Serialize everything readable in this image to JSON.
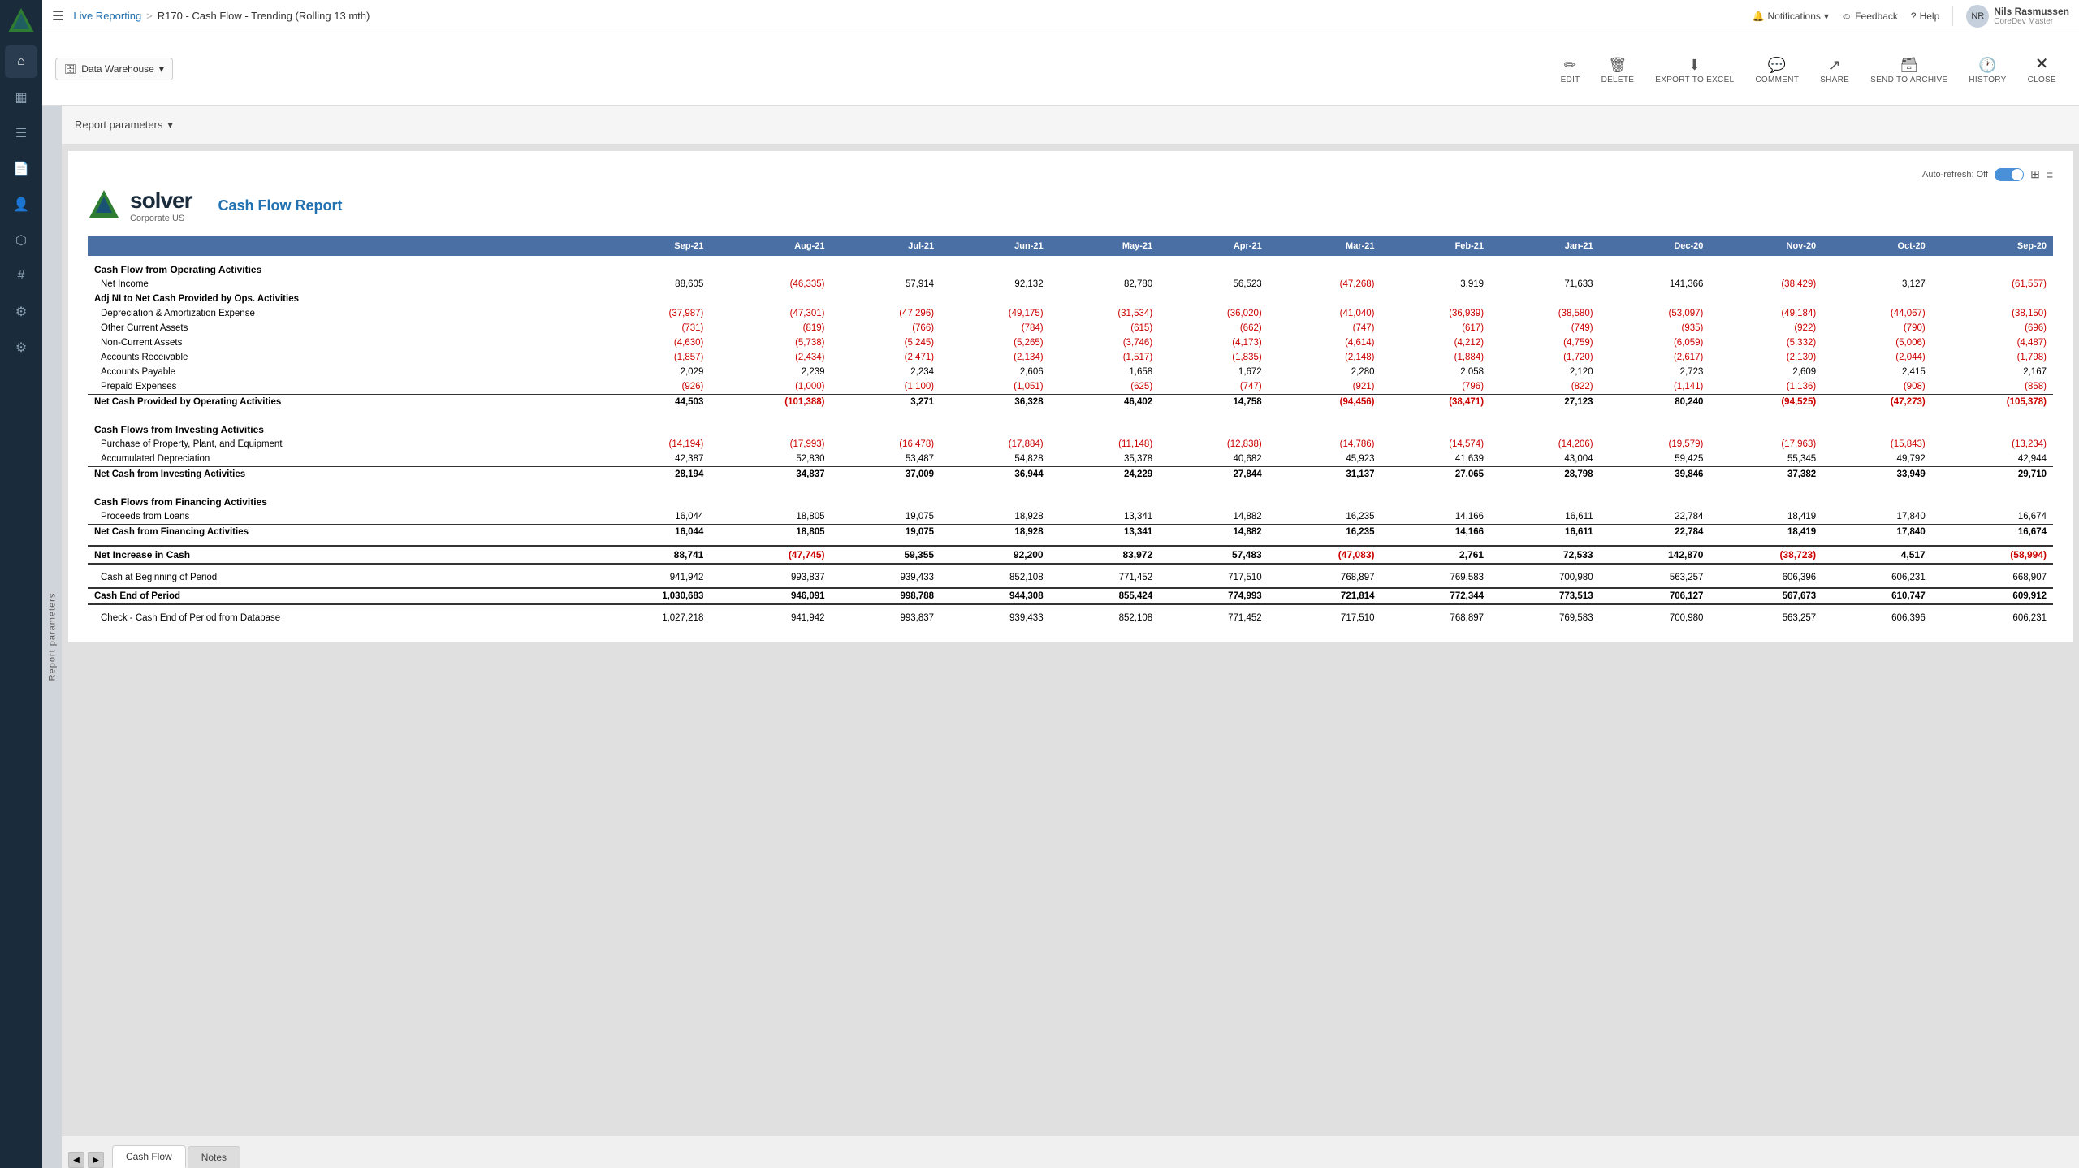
{
  "app": {
    "title": "Live Reporting",
    "breadcrumb_sep": ">",
    "breadcrumb_page": "R170 - Cash Flow - Trending (Rolling 13 mth)"
  },
  "header": {
    "notifications_label": "Notifications",
    "feedback_label": "Feedback",
    "help_label": "Help",
    "user_name": "Nils Rasmussen",
    "user_role": "CoreDev Master"
  },
  "toolbar": {
    "data_warehouse_label": "Data Warehouse",
    "edit_label": "EDIT",
    "delete_label": "DELETE",
    "export_label": "EXPORT TO EXCEL",
    "comment_label": "COMMENT",
    "share_label": "SHARE",
    "send_archive_label": "SEND TO ARCHIVE",
    "history_label": "HISTORY",
    "close_label": "CLOSE"
  },
  "params": {
    "report_params_label": "Report parameters"
  },
  "auto_refresh": {
    "label": "Auto-refresh: Off"
  },
  "report": {
    "logo_text": "solver",
    "logo_subtitle": "Corporate US",
    "title": "Cash Flow Report",
    "columns": [
      "Sep-21",
      "Aug-21",
      "Jul-21",
      "Jun-21",
      "May-21",
      "Apr-21",
      "Mar-21",
      "Feb-21",
      "Jan-21",
      "Dec-20",
      "Nov-20",
      "Oct-20",
      "Sep-20"
    ],
    "sections": [
      {
        "header": "Cash Flow from Operating Activities",
        "rows": [
          {
            "label": "Net Income",
            "values": [
              "88,605",
              "(46,335)",
              "57,914",
              "92,132",
              "82,780",
              "56,523",
              "(47,268)",
              "3,919",
              "71,633",
              "141,366",
              "(38,429)",
              "3,127",
              "(61,557)"
            ],
            "neg": [
              false,
              true,
              false,
              false,
              false,
              false,
              true,
              false,
              false,
              false,
              true,
              false,
              true
            ]
          },
          {
            "label": "Adj NI to Net Cash Provided by Ops. Activities",
            "values": [
              "",
              "",
              "",
              "",
              "",
              "",
              "",
              "",
              "",
              "",
              "",
              "",
              ""
            ],
            "is_subheader": true
          },
          {
            "label": "Depreciation & Amortization Expense",
            "values": [
              "(37,987)",
              "(47,301)",
              "(47,296)",
              "(49,175)",
              "(31,534)",
              "(36,020)",
              "(41,040)",
              "(36,939)",
              "(38,580)",
              "(53,097)",
              "(49,184)",
              "(44,067)",
              "(38,150)"
            ],
            "neg": [
              true,
              true,
              true,
              true,
              true,
              true,
              true,
              true,
              true,
              true,
              true,
              true,
              true
            ]
          },
          {
            "label": "Other Current Assets",
            "values": [
              "(731)",
              "(819)",
              "(766)",
              "(784)",
              "(615)",
              "(662)",
              "(747)",
              "(617)",
              "(749)",
              "(935)",
              "(922)",
              "(790)",
              "(696)"
            ],
            "neg": [
              true,
              true,
              true,
              true,
              true,
              true,
              true,
              true,
              true,
              true,
              true,
              true,
              true
            ]
          },
          {
            "label": "Non-Current Assets",
            "values": [
              "(4,630)",
              "(5,738)",
              "(5,245)",
              "(5,265)",
              "(3,746)",
              "(4,173)",
              "(4,614)",
              "(4,212)",
              "(4,759)",
              "(6,059)",
              "(5,332)",
              "(5,006)",
              "(4,487)"
            ],
            "neg": [
              true,
              true,
              true,
              true,
              true,
              true,
              true,
              true,
              true,
              true,
              true,
              true,
              true
            ]
          },
          {
            "label": "Accounts Receivable",
            "values": [
              "(1,857)",
              "(2,434)",
              "(2,471)",
              "(2,134)",
              "(1,517)",
              "(1,835)",
              "(2,148)",
              "(1,884)",
              "(1,720)",
              "(2,617)",
              "(2,130)",
              "(2,044)",
              "(1,798)"
            ],
            "neg": [
              true,
              true,
              true,
              true,
              true,
              true,
              true,
              true,
              true,
              true,
              true,
              true,
              true
            ]
          },
          {
            "label": "Accounts Payable",
            "values": [
              "2,029",
              "2,239",
              "2,234",
              "2,606",
              "1,658",
              "1,672",
              "2,280",
              "2,058",
              "2,120",
              "2,723",
              "2,609",
              "2,415",
              "2,167"
            ],
            "neg": [
              false,
              false,
              false,
              false,
              false,
              false,
              false,
              false,
              false,
              false,
              false,
              false,
              false
            ]
          },
          {
            "label": "Prepaid Expenses",
            "values": [
              "(926)",
              "(1,000)",
              "(1,100)",
              "(1,051)",
              "(625)",
              "(747)",
              "(921)",
              "(796)",
              "(822)",
              "(1,141)",
              "(1,136)",
              "(908)",
              "(858)"
            ],
            "neg": [
              true,
              true,
              true,
              true,
              true,
              true,
              true,
              true,
              true,
              true,
              true,
              true,
              true
            ]
          }
        ],
        "subtotal": {
          "label": "Net Cash Provided by Operating Activities",
          "values": [
            "44,503",
            "(101,388)",
            "3,271",
            "36,328",
            "46,402",
            "14,758",
            "(94,456)",
            "(38,471)",
            "27,123",
            "80,240",
            "(94,525)",
            "(47,273)",
            "(105,378)"
          ],
          "neg": [
            false,
            true,
            false,
            false,
            false,
            false,
            true,
            true,
            false,
            false,
            true,
            true,
            true
          ]
        }
      },
      {
        "header": "Cash Flows from Investing Activities",
        "rows": [
          {
            "label": "Purchase of Property, Plant, and Equipment",
            "values": [
              "(14,194)",
              "(17,993)",
              "(16,478)",
              "(17,884)",
              "(11,148)",
              "(12,838)",
              "(14,786)",
              "(14,574)",
              "(14,206)",
              "(19,579)",
              "(17,963)",
              "(15,843)",
              "(13,234)"
            ],
            "neg": [
              true,
              true,
              true,
              true,
              true,
              true,
              true,
              true,
              true,
              true,
              true,
              true,
              true
            ]
          },
          {
            "label": "Accumulated Depreciation",
            "values": [
              "42,387",
              "52,830",
              "53,487",
              "54,828",
              "35,378",
              "40,682",
              "45,923",
              "41,639",
              "43,004",
              "59,425",
              "55,345",
              "49,792",
              "42,944"
            ],
            "neg": [
              false,
              false,
              false,
              false,
              false,
              false,
              false,
              false,
              false,
              false,
              false,
              false,
              false
            ]
          }
        ],
        "subtotal": {
          "label": "Net Cash from Investing Activities",
          "values": [
            "28,194",
            "34,837",
            "37,009",
            "36,944",
            "24,229",
            "27,844",
            "31,137",
            "27,065",
            "28,798",
            "39,846",
            "37,382",
            "33,949",
            "29,710"
          ],
          "neg": [
            false,
            false,
            false,
            false,
            false,
            false,
            false,
            false,
            false,
            false,
            false,
            false,
            false
          ]
        }
      },
      {
        "header": "Cash Flows from Financing Activities",
        "rows": [
          {
            "label": "Proceeds from Loans",
            "values": [
              "16,044",
              "18,805",
              "19,075",
              "18,928",
              "13,341",
              "14,882",
              "16,235",
              "14,166",
              "16,611",
              "22,784",
              "18,419",
              "17,840",
              "16,674"
            ],
            "neg": [
              false,
              false,
              false,
              false,
              false,
              false,
              false,
              false,
              false,
              false,
              false,
              false,
              false
            ]
          }
        ],
        "subtotal": {
          "label": "Net Cash from Financing Activities",
          "values": [
            "16,044",
            "18,805",
            "19,075",
            "18,928",
            "13,341",
            "14,882",
            "16,235",
            "14,166",
            "16,611",
            "22,784",
            "18,419",
            "17,840",
            "16,674"
          ],
          "neg": [
            false,
            false,
            false,
            false,
            false,
            false,
            false,
            false,
            false,
            false,
            false,
            false,
            false
          ]
        }
      }
    ],
    "net_increase": {
      "label": "Net Increase in Cash",
      "values": [
        "88,741",
        "(47,745)",
        "59,355",
        "92,200",
        "83,972",
        "57,483",
        "(47,083)",
        "2,761",
        "72,533",
        "142,870",
        "(38,723)",
        "4,517",
        "(58,994)"
      ],
      "neg": [
        false,
        true,
        false,
        false,
        false,
        false,
        true,
        false,
        false,
        false,
        true,
        false,
        true
      ]
    },
    "cash_beginning": {
      "label": "Cash at Beginning of Period",
      "values": [
        "941,942",
        "993,837",
        "939,433",
        "852,108",
        "771,452",
        "717,510",
        "768,897",
        "769,583",
        "700,980",
        "563,257",
        "606,396",
        "606,231",
        "668,907"
      ],
      "neg": [
        false,
        false,
        false,
        false,
        false,
        false,
        false,
        false,
        false,
        false,
        false,
        false,
        false
      ]
    },
    "cash_end": {
      "label": "Cash End of Period",
      "values": [
        "1,030,683",
        "946,091",
        "998,788",
        "944,308",
        "855,424",
        "774,993",
        "721,814",
        "772,344",
        "773,513",
        "706,127",
        "567,673",
        "610,747",
        "609,912"
      ],
      "neg": [
        false,
        false,
        false,
        false,
        false,
        false,
        false,
        false,
        false,
        false,
        false,
        false,
        false
      ]
    },
    "check_row": {
      "label": "Check - Cash End of Period from Database",
      "values": [
        "1,027,218",
        "941,942",
        "993,837",
        "939,433",
        "852,108",
        "771,452",
        "717,510",
        "768,897",
        "769,583",
        "700,980",
        "563,257",
        "606,396",
        "606,231"
      ],
      "neg": [
        false,
        false,
        false,
        false,
        false,
        false,
        false,
        false,
        false,
        false,
        false,
        false,
        false
      ]
    }
  },
  "tabs": [
    {
      "label": "Cash Flow",
      "active": true
    },
    {
      "label": "Notes",
      "active": false
    }
  ],
  "sidebar": {
    "icons": [
      "home",
      "chart-bar",
      "grid",
      "file",
      "people",
      "layers",
      "settings",
      "wrench",
      "gear"
    ]
  }
}
